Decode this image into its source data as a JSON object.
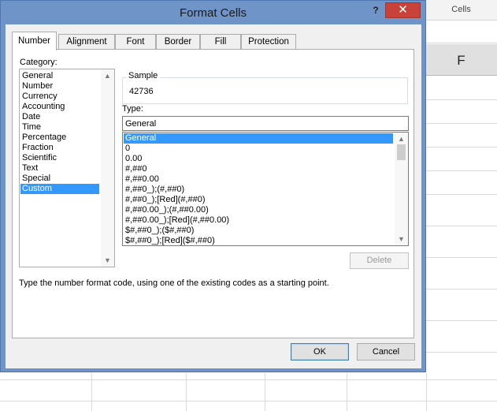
{
  "dialog": {
    "title": "Format Cells",
    "help_label": "?",
    "close_label": "✕"
  },
  "tabs": [
    "Number",
    "Alignment",
    "Font",
    "Border",
    "Fill",
    "Protection"
  ],
  "active_tab": "Number",
  "category": {
    "label": "Category:",
    "items": [
      "General",
      "Number",
      "Currency",
      "Accounting",
      "Date",
      "Time",
      "Percentage",
      "Fraction",
      "Scientific",
      "Text",
      "Special",
      "Custom"
    ],
    "selected": "Custom"
  },
  "sample": {
    "label": "Sample",
    "value": "42736"
  },
  "type": {
    "label": "Type:",
    "value": "General",
    "codes": [
      "General",
      "0",
      "0.00",
      "#,##0",
      "#,##0.00",
      "#,##0_);(#,##0)",
      "#,##0_);[Red](#,##0)",
      "#,##0.00_);(#,##0.00)",
      "#,##0.00_);[Red](#,##0.00)",
      "$#,##0_);($#,##0)",
      "$#,##0_);[Red]($#,##0)"
    ],
    "selected": "General"
  },
  "buttons": {
    "delete": "Delete",
    "ok": "OK",
    "cancel": "Cancel"
  },
  "hint": "Type the number format code, using one of the existing codes as a starting point.",
  "spreadsheet": {
    "ribbon_group_label": "Cells",
    "column_header": "F"
  },
  "colors": {
    "dialog_frame": "#6f95c8",
    "close_button": "#c9423a",
    "selection": "#3399ff",
    "panel": "#f0f0f0"
  }
}
